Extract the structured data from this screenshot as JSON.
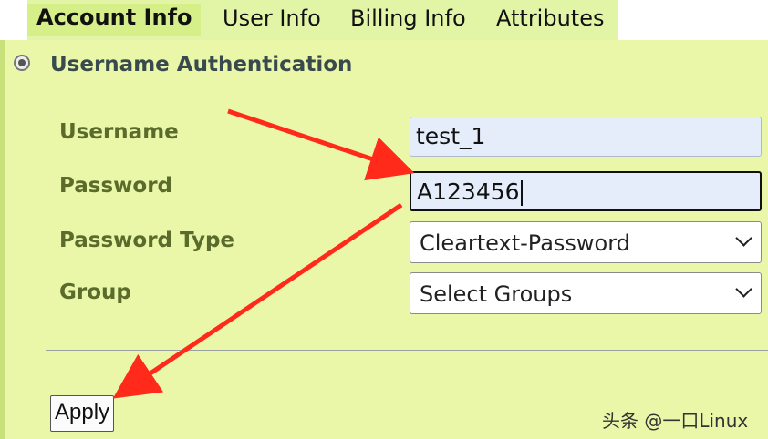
{
  "tabs": [
    {
      "label": "Account Info",
      "active": true
    },
    {
      "label": "User Info",
      "active": false
    },
    {
      "label": "Billing Info",
      "active": false
    },
    {
      "label": "Attributes",
      "active": false
    }
  ],
  "section": {
    "title": "Username Authentication"
  },
  "form": {
    "username": {
      "label": "Username",
      "value": "test_1"
    },
    "password": {
      "label": "Password",
      "value": "A123456"
    },
    "password_type": {
      "label": "Password Type",
      "selected": "Cleartext-Password"
    },
    "group": {
      "label": "Group",
      "selected": "Select Groups"
    }
  },
  "apply_label": "Apply",
  "watermark": "头条 @一口Linux",
  "colors": {
    "tab_bar_bg": "#e2f5a6",
    "panel_bg": "#eaf7a9",
    "label_color": "#5a6b2b",
    "annotation_arrow": "#ff2a1a"
  }
}
